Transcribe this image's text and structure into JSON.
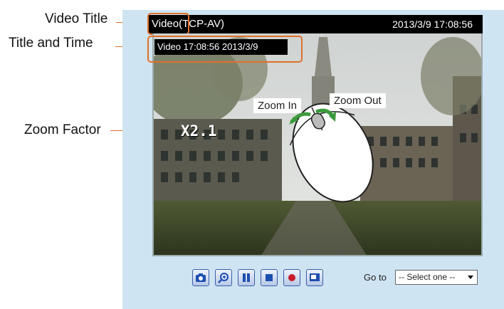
{
  "callouts": {
    "video_title": "Video Title",
    "title_and_time": "Title and Time",
    "zoom_factor": "Zoom Factor"
  },
  "title_bar": {
    "title_prefix": "Video",
    "title_suffix": "(TCP-AV)",
    "datetime": "2013/3/9  17:08:56"
  },
  "overlay": {
    "text": "Video 17:08:56  2013/3/9",
    "zoom_factor": "X2.1",
    "zoom_in": "Zoom In",
    "zoom_out": "Zoom Out"
  },
  "toolbar": {
    "buttons": [
      "snapshot-icon",
      "zoom-icon",
      "pause-icon",
      "stop-icon",
      "record-icon",
      "pip-icon"
    ],
    "goto_label": "Go to",
    "goto_selected": "-- Select one --"
  },
  "colors": {
    "panel": "#cfe4f3",
    "callout_accent": "#e0702a",
    "button_border": "#3a5ea8"
  }
}
